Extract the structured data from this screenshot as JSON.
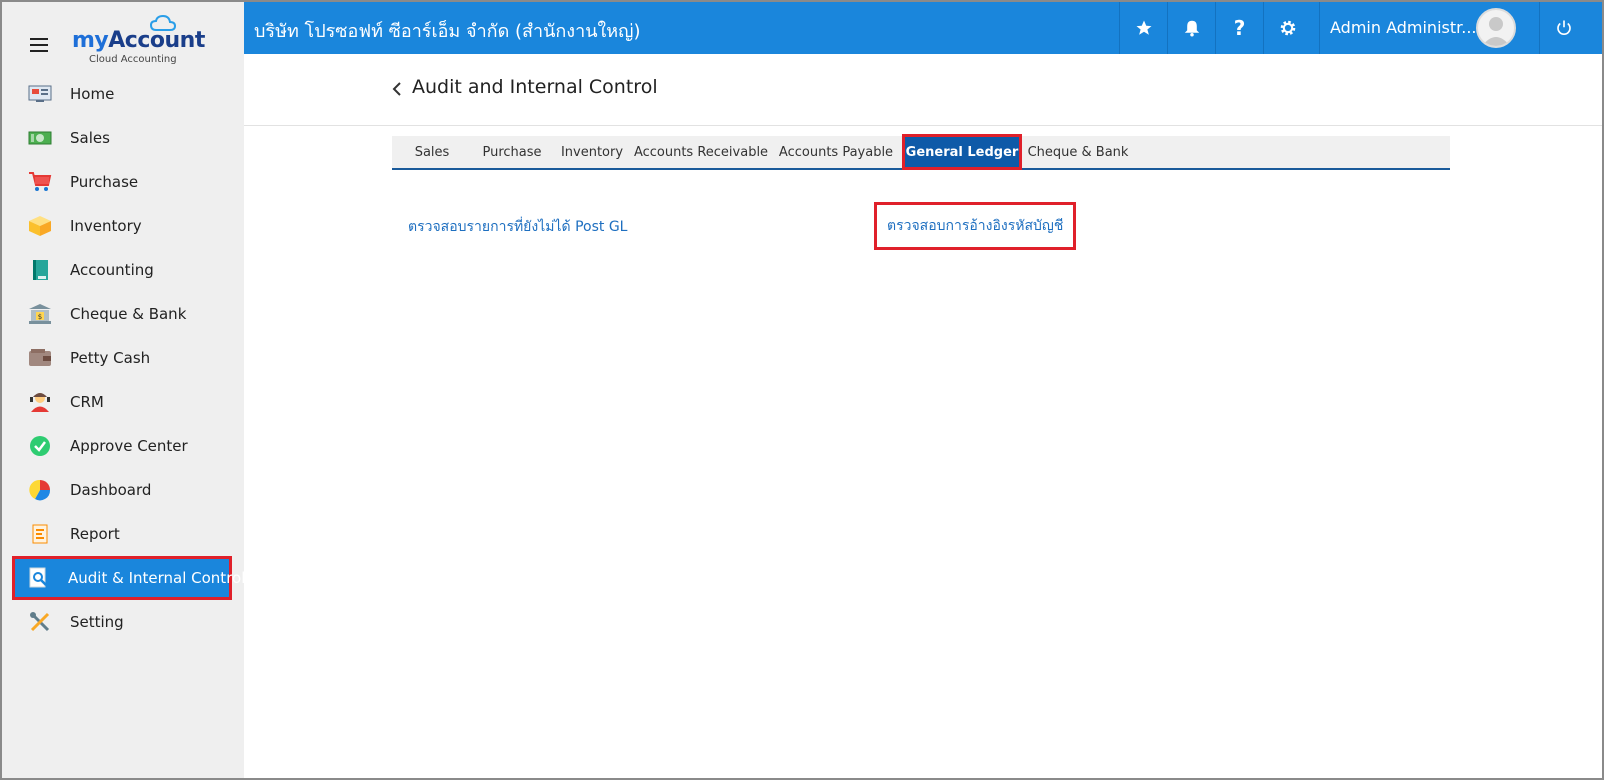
{
  "brand": {
    "logo_main_prefix": "my",
    "logo_main_suffix": "Account",
    "logo_sub": "Cloud Accounting"
  },
  "topbar": {
    "company": "บริษัท โปรซอฟท์ ซีอาร์เอ็ม จำกัด (สำนักงานใหญ่)",
    "user_name": "Admin Administr...",
    "help_glyph": "?"
  },
  "sidebar": {
    "items": [
      {
        "label": "Home",
        "icon": "home-icon"
      },
      {
        "label": "Sales",
        "icon": "sales-icon"
      },
      {
        "label": "Purchase",
        "icon": "cart-icon"
      },
      {
        "label": "Inventory",
        "icon": "box-icon"
      },
      {
        "label": "Accounting",
        "icon": "book-icon"
      },
      {
        "label": "Cheque & Bank",
        "icon": "bank-icon"
      },
      {
        "label": "Petty Cash",
        "icon": "wallet-icon"
      },
      {
        "label": "CRM",
        "icon": "crm-icon"
      },
      {
        "label": "Approve Center",
        "icon": "check-circle-icon"
      },
      {
        "label": "Dashboard",
        "icon": "pie-chart-icon"
      },
      {
        "label": "Report",
        "icon": "report-icon"
      },
      {
        "label": "Audit & Internal Control",
        "icon": "audit-icon",
        "active": true
      },
      {
        "label": "Setting",
        "icon": "tools-icon"
      }
    ]
  },
  "main": {
    "title": "Audit and Internal Control",
    "tabs": [
      {
        "label": "Sales"
      },
      {
        "label": "Purchase"
      },
      {
        "label": "Inventory"
      },
      {
        "label": "Accounts Receivable"
      },
      {
        "label": "Accounts Payable"
      },
      {
        "label": "General Ledger",
        "active": true
      },
      {
        "label": "Cheque & Bank"
      }
    ],
    "links": [
      {
        "label": "ตรวจสอบรายการที่ยังไม่ได้ Post GL"
      },
      {
        "label": "ตรวจสอบการอ้างอิงรหัสบัญชี",
        "highlighted": true
      }
    ]
  },
  "colors": {
    "primary": "#1a86dc",
    "highlight": "#e0202a",
    "active_tab": "#0e5aa8",
    "link": "#1e6fc0"
  }
}
